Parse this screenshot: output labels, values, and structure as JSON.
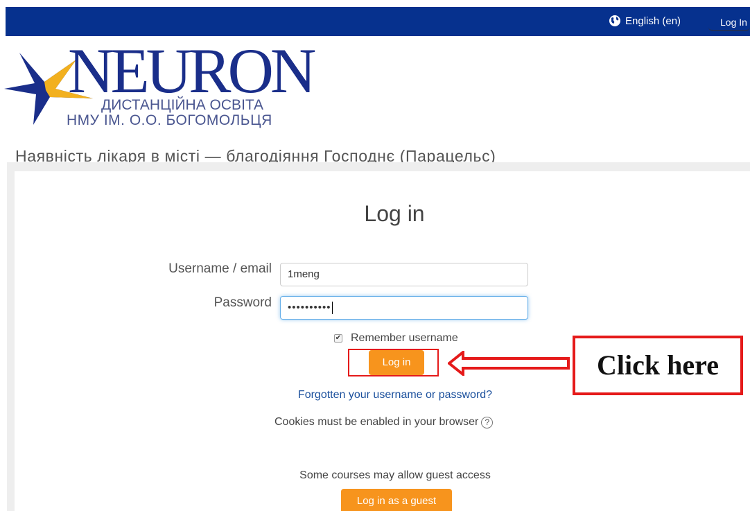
{
  "topbar": {
    "language": "English (en)",
    "login": "Log In"
  },
  "logo": {
    "title": "NEURON",
    "subtitle1": "ДИСТАНЦІЙНА ОСВІТА",
    "subtitle2": "НМУ ІМ. О.О. БОГОМОЛЬЦЯ"
  },
  "tagline": "Наявність лікаря в місті — благодіяння Господнє (Парацельс)",
  "login": {
    "heading": "Log in",
    "username_label": "Username / email",
    "username_value": "1meng",
    "password_label": "Password",
    "password_mask": "••••••••••",
    "remember_label": "Remember username",
    "remember_checked": true,
    "login_button": "Log in",
    "forgot_link": "Forgotten your username or password?",
    "cookies_text": "Cookies must be enabled in your browser",
    "guest_text": "Some courses may allow guest access",
    "guest_button": "Log in as a guest"
  },
  "annotation": {
    "callout_text": "Click here"
  },
  "colors": {
    "topbar": "#06318e",
    "accent_button": "#f7941d",
    "annotation_red": "#e51a1a",
    "link": "#1a4f9c",
    "logo_blue": "#1a2e8a",
    "logo_gold": "#f2b01e"
  },
  "icons": {
    "language": "globe-icon",
    "help": "question-circle-icon",
    "pointer": "left-arrow-icon"
  }
}
